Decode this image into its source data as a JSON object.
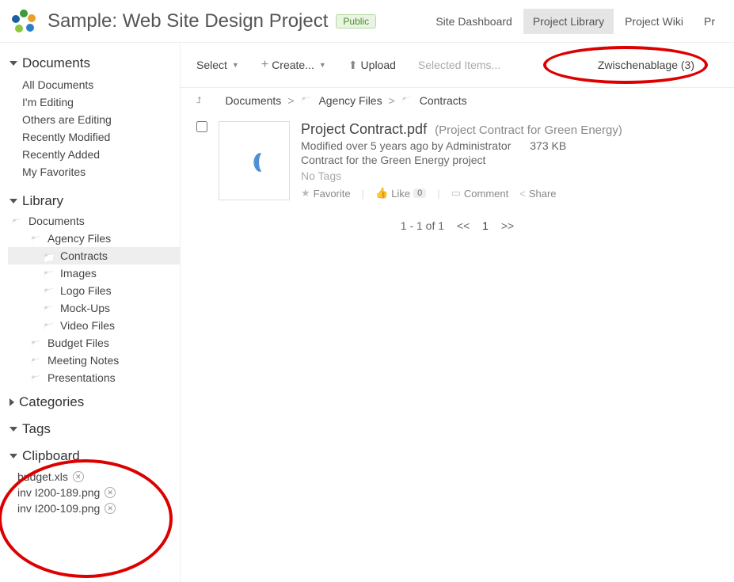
{
  "header": {
    "title": "Sample: Web Site Design Project",
    "badge": "Public",
    "nav": {
      "dashboard": "Site Dashboard",
      "library": "Project Library",
      "wiki": "Project Wiki",
      "cut": "Pr"
    }
  },
  "sidebar": {
    "documents": {
      "title": "Documents",
      "items": {
        "all": "All Documents",
        "editing": "I'm Editing",
        "others": "Others are Editing",
        "modified": "Recently Modified",
        "added": "Recently Added",
        "favorites": "My Favorites"
      }
    },
    "library": {
      "title": "Library",
      "root": "Documents",
      "agency": "Agency Files",
      "contracts": "Contracts",
      "images": "Images",
      "logo": "Logo Files",
      "mockups": "Mock-Ups",
      "video": "Video Files",
      "budget": "Budget Files",
      "meeting": "Meeting Notes",
      "presentations": "Presentations"
    },
    "categories": {
      "title": "Categories"
    },
    "tags": {
      "title": "Tags"
    },
    "clipboard": {
      "title": "Clipboard",
      "items": {
        "a": "budget.xls",
        "b": "inv I200-189.png",
        "c": "inv I200-109.png"
      }
    }
  },
  "toolbar": {
    "select": "Select",
    "create": "Create...",
    "upload": "Upload",
    "selected": "Selected Items...",
    "clipboard": "Zwischenablage (3)"
  },
  "breadcrumb": {
    "a": "Documents",
    "b": "Agency Files",
    "c": "Contracts"
  },
  "doc": {
    "title": "Project Contract.pdf",
    "subtitle": "(Project Contract for Green Energy)",
    "modified": "Modified over 5 years ago by Administrator",
    "size": "373 KB",
    "desc": "Contract for the Green Energy project",
    "tags": "No Tags",
    "favorite": "Favorite",
    "like": "Like",
    "like_count": "0",
    "comment": "Comment",
    "share": "Share"
  },
  "pager": {
    "range": "1 - 1 of 1",
    "prev": "<<",
    "page": "1",
    "next": ">>"
  }
}
